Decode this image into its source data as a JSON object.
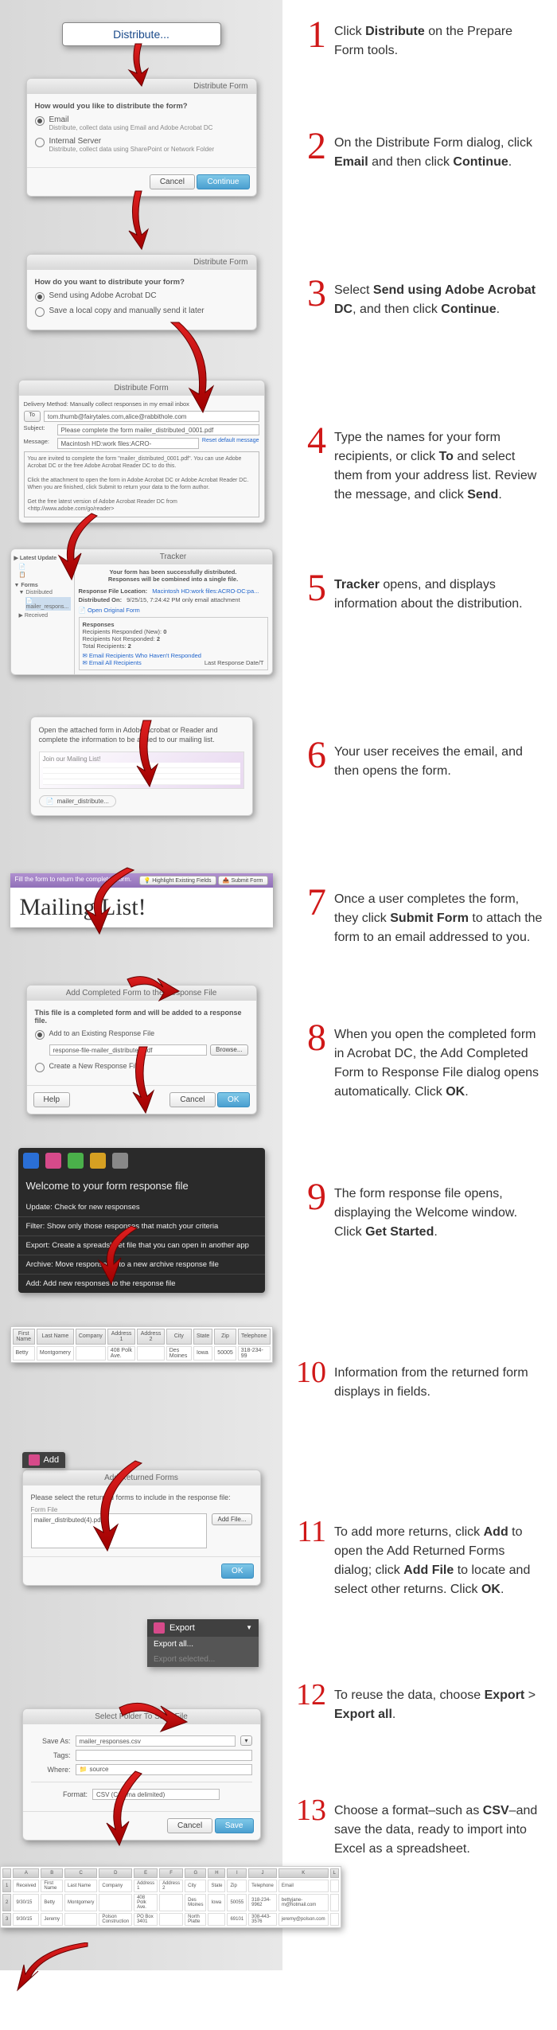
{
  "steps": [
    {
      "n": "1",
      "html": "Click <b>Distribute</b> on the Prepare Form tools."
    },
    {
      "n": "2",
      "html": "On the Distribute Form dialog, click <b>Email</b> and then click <b>Continue</b>."
    },
    {
      "n": "3",
      "html": "Select <b>Send using Adobe Acrobat DC</b>, and then click <b>Continue</b>."
    },
    {
      "n": "4",
      "html": "Type the names for your form recipients, or click <b>To</b> and select them from your address list. Review the message, and click <b>Send</b>."
    },
    {
      "n": "5",
      "html": "<b>Tracker</b> opens, and displays information about the distribution."
    },
    {
      "n": "6",
      "html": "Your user receives the email, and then opens the form."
    },
    {
      "n": "7",
      "html": "Once a user completes the form, they click <b>Submit Form</b> to attach the form to an email addressed to you."
    },
    {
      "n": "8",
      "html": "When you open the completed form in Acrobat DC, the Add Completed Form to Response File dialog opens automatically. Click <b>OK</b>."
    },
    {
      "n": "9",
      "html": "The form response file opens, displaying the Welcome window. Click <b>Get Started</b>."
    },
    {
      "n": "10",
      "html": "Information from the returned form displays in fields."
    },
    {
      "n": "11",
      "html": "To add more returns, click <b>Add</b> to open the Add Returned Forms dialog; click <b>Add File</b> to locate and select other returns. Click <b>OK</b>."
    },
    {
      "n": "12",
      "html": "To reuse the data, choose <b>Export</b> > <b>Export all</b>."
    },
    {
      "n": "13",
      "html": "Choose a format–such as <b>CSV</b>–and save the data, ready to import into Excel as a spreadsheet."
    }
  ],
  "dist_btn": "Distribute...",
  "m2": {
    "title": "Distribute Form",
    "q": "How would you like to distribute the form?",
    "opt1": "Email",
    "sub1": "Distribute, collect data using Email and Adobe Acrobat DC",
    "opt2": "Internal Server",
    "sub2": "Distribute, collect data using SharePoint or Network Folder",
    "cancel": "Cancel",
    "cont": "Continue"
  },
  "m3": {
    "title": "Distribute Form",
    "q": "How do you want to distribute your form?",
    "opt1": "Send using Adobe Acrobat DC",
    "opt2": "Save a local copy and manually send it later"
  },
  "m4": {
    "title": "Distribute Form",
    "method": "Delivery Method:    Manually collect responses in my email inbox",
    "to": "To",
    "toval": "tom.thumb@fairytales.com,alice@rabbithole.com",
    "subj": "Subject:",
    "subjval": "Please complete the form mailer_distributed_0001.pdf",
    "msg": "Message:",
    "msgval": "Macintosh HD:work files:ACRO-DC:paperwork....",
    "reset": "Reset default message",
    "body": "You are invited to complete the form \"mailer_distributed_0001.pdf\". You can use Adobe Acrobat DC or the free Adobe Acrobat Reader DC to do this.\n\nClick the attachment to open the form in Adobe Acrobat DC or Adobe Acrobat Reader DC. When you are finished, click Submit to return your data to the form author.\n\nGet the free latest version of Adobe Acrobat Reader DC from\n<http://www.adobe.com/go/reader>"
  },
  "m5": {
    "title": "Tracker",
    "hdr": "Your form has been successfully distributed.\nResponses will be combined into a single file.",
    "rf": "Response File Location:",
    "rfval": "Macintosh HD:work files:ACRO-DC:pa...",
    "date": "Distributed On:",
    "dateval": "9/25/15, 7:24:42 PM only email attachment",
    "open": "Open Original Form",
    "resp": "Responses",
    "r1": "Recipients Responded (New):",
    "r1v": "0",
    "r2": "Recipients Not Responded:",
    "r2v": "2",
    "r3": "Total Recipients:",
    "r3v": "2",
    "email": "Email Recipients Who Haven't Responded",
    "email2": "Email All Recipients",
    "last": "Last Response Date/T"
  },
  "m6": {
    "txt": "Open the attached form in Adobe Acrobat or Reader and complete the information to be added to our mailing list.",
    "join": "Join our Mailing List!",
    "file": "mailer_distribute..."
  },
  "m7": {
    "txt": "Fill the form to return the completed form.",
    "hl": "Highlight Existing Fields",
    "sub": "Submit Form",
    "head": "Mailing List!"
  },
  "m8": {
    "title": "Add Completed Form to the Response File",
    "txt": "This file is a completed form and will be added to a response file.",
    "opt1": "Add to an Existing Response File",
    "opt2": "Create a New Response File",
    "file": "response-file-mailer_distributed.pdf",
    "browse": "Browse...",
    "help": "Help",
    "cancel": "Cancel",
    "ok": "OK"
  },
  "m9": {
    "title": "Welcome to your form response file",
    "r1": "Update: Check for new responses",
    "r2": "Filter: Show only those responses that match your criteria",
    "r3": "Export: Create a spreadsheet file that you can open in another app",
    "r4": "Archive: Move responses into a new archive response file",
    "r5": "Add: Add new responses to the response file"
  },
  "m10": {
    "cols": [
      "First Name",
      "Last Name",
      "Company",
      "Address 1",
      "Address 2",
      "City",
      "State",
      "Zip",
      "Telephone"
    ],
    "row": [
      "Betty",
      "Montgomery",
      "",
      "408 Polk Ave.",
      "",
      "Des Moines",
      "Iowa",
      "50005",
      "318-234-99"
    ]
  },
  "m11": {
    "add": "Add",
    "title": "Add Returned Forms",
    "txt": "Please select the returned forms to include in the response file:",
    "ff": "Form File",
    "file": "mailer_distributed(4).pdf",
    "addf": "Add File...",
    "ok": "OK"
  },
  "m12": {
    "exp": "Export",
    "all": "Export all...",
    "sel": "Export selected..."
  },
  "m13": {
    "title": "Select Folder To Save File",
    "sa": "Save As:",
    "sav": "mailer_responses.csv",
    "tags": "Tags:",
    "where": "Where:",
    "wherev": "source",
    "format": "Format:",
    "formatv": "CSV (Comma delimited)",
    "cancel": "Cancel",
    "save": "Save"
  },
  "m14": {
    "cols": [
      "",
      "A",
      "B",
      "C",
      "D",
      "E",
      "F",
      "G",
      "H",
      "I",
      "J",
      "K",
      "L"
    ],
    "hr": [
      "1",
      "Received",
      "First Name",
      "Last Name",
      "Company",
      "Address 1",
      "Address 2",
      "City",
      "State",
      "Zip",
      "Telephone",
      "Email",
      ""
    ],
    "r1": [
      "2",
      "9/30/15",
      "Betty",
      "Montgomery",
      "",
      "408 Polk Ave.",
      "",
      "Des Moines",
      "Iowa",
      "50055",
      "318-234-9962",
      "bettyjane-m@hotmail.com",
      ""
    ],
    "r2": [
      "3",
      "9/30/15",
      "Jeremy",
      "",
      "Polson Construction",
      "PO Box 3401",
      "",
      "North Platte",
      "",
      "69101",
      "308-443-3576",
      "jeremy@polson.com",
      ""
    ]
  }
}
